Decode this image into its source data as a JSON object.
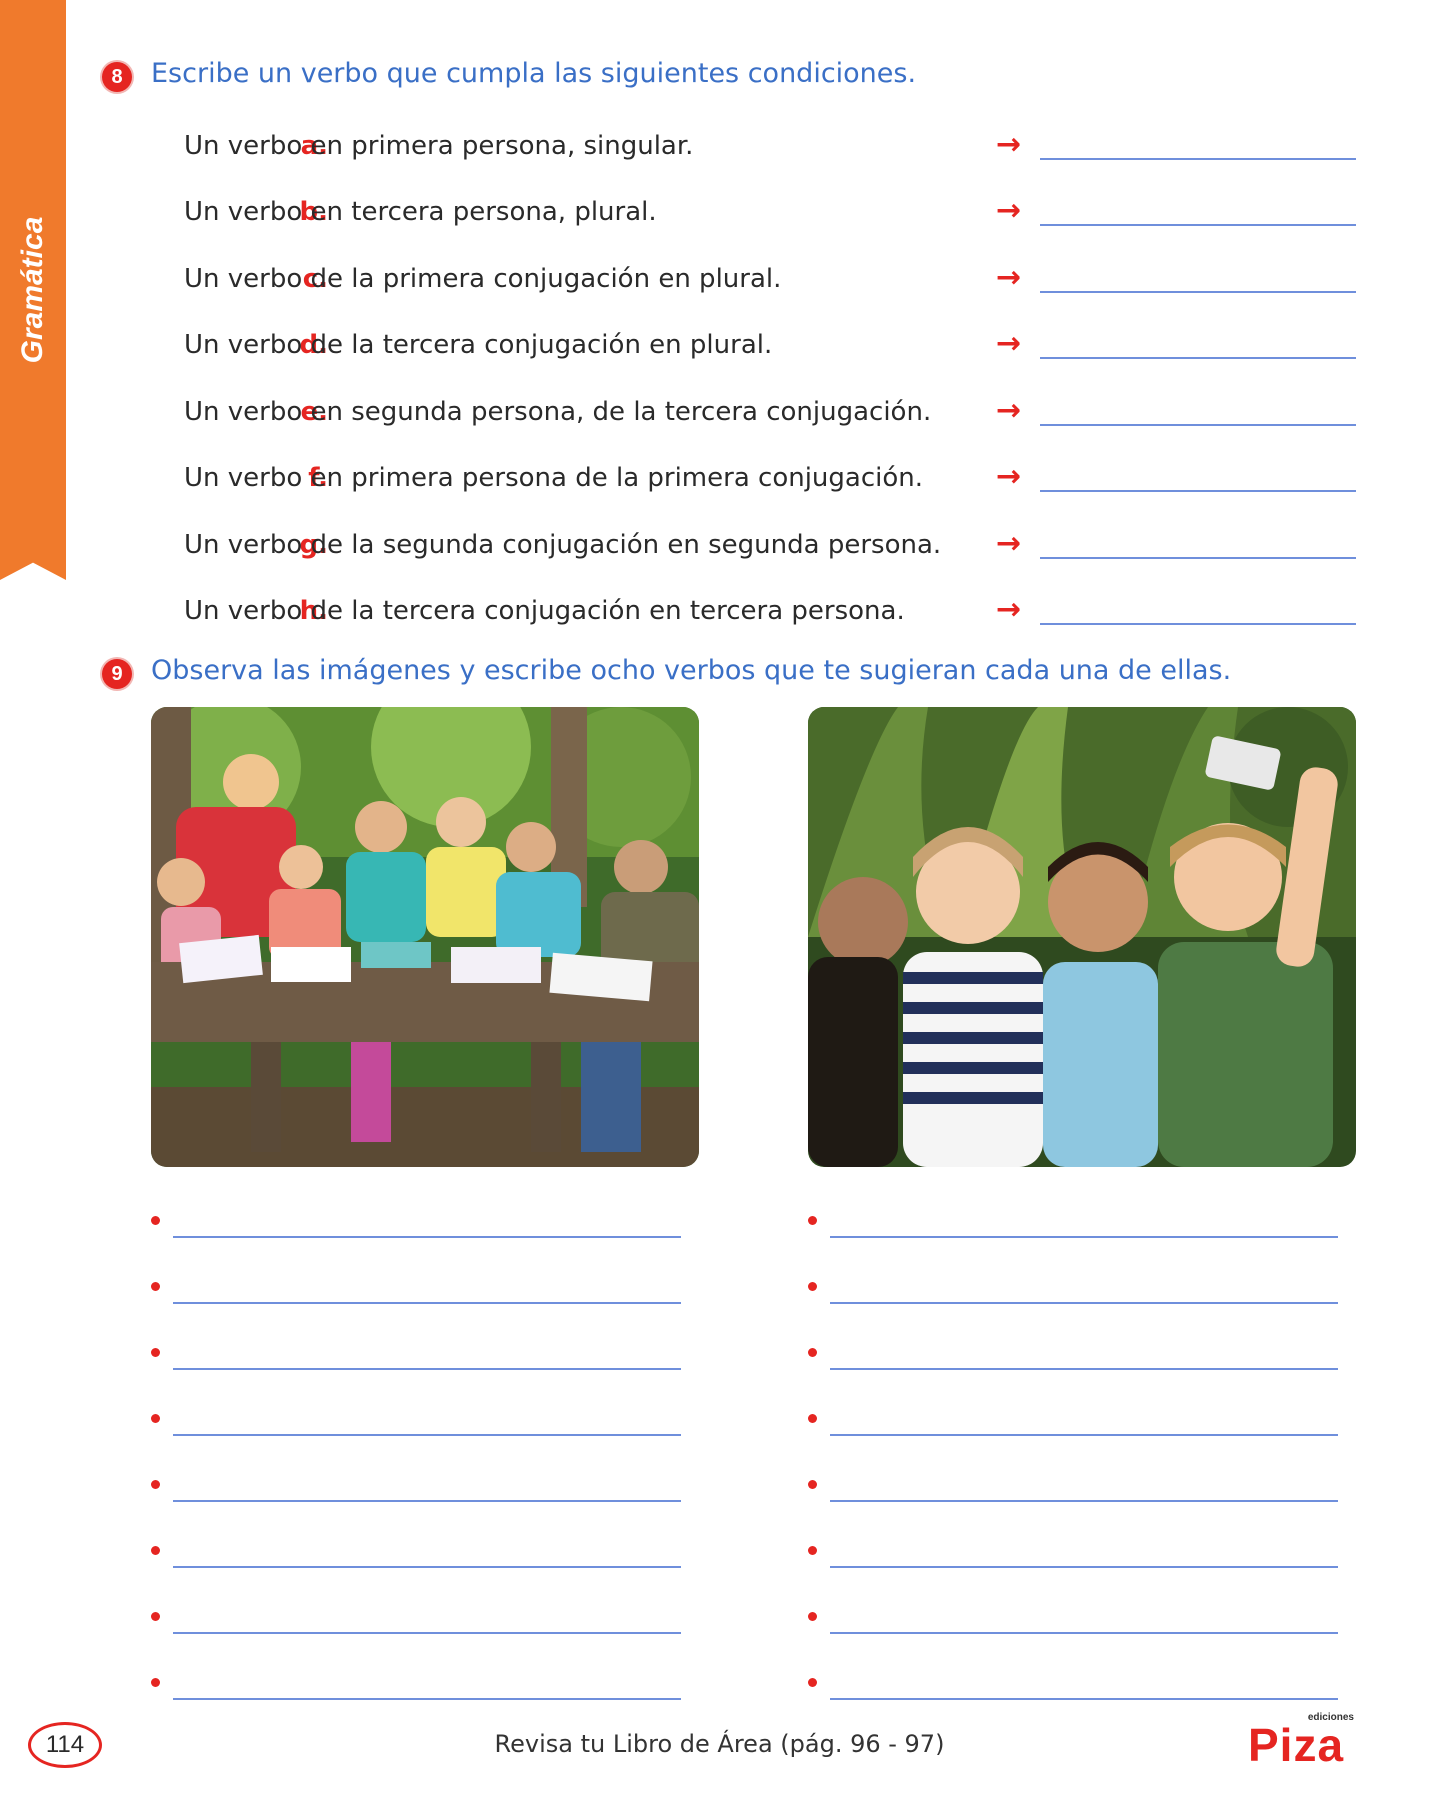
{
  "side_tab": {
    "label": "Gramática"
  },
  "exercise8": {
    "number": "8",
    "title": "Escribe un verbo que cumpla las siguientes condiciones.",
    "items": [
      {
        "letter": "a.",
        "text": "Un verbo en primera persona, singular."
      },
      {
        "letter": "b.",
        "text": "Un verbo en tercera persona, plural."
      },
      {
        "letter": "c.",
        "text": "Un verbo de la primera conjugación en plural."
      },
      {
        "letter": "d.",
        "text": "Un verbo de la tercera conjugación en plural."
      },
      {
        "letter": "e.",
        "text": "Un verbo en segunda persona, de la tercera conjugación."
      },
      {
        "letter": "f.",
        "text": "Un verbo en primera persona de la primera conjugación."
      },
      {
        "letter": "g.",
        "text": "Un verbo de la segunda conjugación en segunda persona."
      },
      {
        "letter": "h.",
        "text": "Un verbo de la tercera conjugación en tercera persona."
      }
    ],
    "arrow_icon": "right-arrow-icon"
  },
  "exercise9": {
    "number": "9",
    "title": "Observa las imágenes y escribe ocho verbos que te sugieran cada una de ellas."
  },
  "footer": {
    "page_number": "114",
    "note": "Revisa tu Libro de Área (pág. 96 - 97)",
    "logo_small": "ediciones",
    "logo_main": "Piza"
  },
  "colors": {
    "accent_orange": "#f07a2c",
    "accent_red": "#e52521",
    "title_blue": "#3a6fc6",
    "line_blue": "#6f8fdc"
  }
}
